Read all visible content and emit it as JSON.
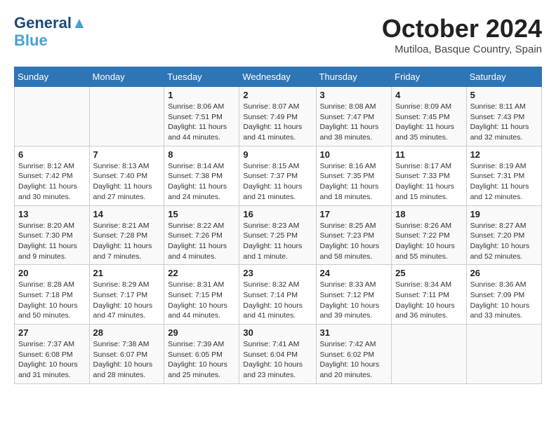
{
  "logo": {
    "line1": "General",
    "line2": "Blue"
  },
  "title": "October 2024",
  "location": "Mutiloa, Basque Country, Spain",
  "headers": [
    "Sunday",
    "Monday",
    "Tuesday",
    "Wednesday",
    "Thursday",
    "Friday",
    "Saturday"
  ],
  "weeks": [
    [
      {
        "day": "",
        "detail": ""
      },
      {
        "day": "",
        "detail": ""
      },
      {
        "day": "1",
        "detail": "Sunrise: 8:06 AM\nSunset: 7:51 PM\nDaylight: 11 hours and 44 minutes."
      },
      {
        "day": "2",
        "detail": "Sunrise: 8:07 AM\nSunset: 7:49 PM\nDaylight: 11 hours and 41 minutes."
      },
      {
        "day": "3",
        "detail": "Sunrise: 8:08 AM\nSunset: 7:47 PM\nDaylight: 11 hours and 38 minutes."
      },
      {
        "day": "4",
        "detail": "Sunrise: 8:09 AM\nSunset: 7:45 PM\nDaylight: 11 hours and 35 minutes."
      },
      {
        "day": "5",
        "detail": "Sunrise: 8:11 AM\nSunset: 7:43 PM\nDaylight: 11 hours and 32 minutes."
      }
    ],
    [
      {
        "day": "6",
        "detail": "Sunrise: 8:12 AM\nSunset: 7:42 PM\nDaylight: 11 hours and 30 minutes."
      },
      {
        "day": "7",
        "detail": "Sunrise: 8:13 AM\nSunset: 7:40 PM\nDaylight: 11 hours and 27 minutes."
      },
      {
        "day": "8",
        "detail": "Sunrise: 8:14 AM\nSunset: 7:38 PM\nDaylight: 11 hours and 24 minutes."
      },
      {
        "day": "9",
        "detail": "Sunrise: 8:15 AM\nSunset: 7:37 PM\nDaylight: 11 hours and 21 minutes."
      },
      {
        "day": "10",
        "detail": "Sunrise: 8:16 AM\nSunset: 7:35 PM\nDaylight: 11 hours and 18 minutes."
      },
      {
        "day": "11",
        "detail": "Sunrise: 8:17 AM\nSunset: 7:33 PM\nDaylight: 11 hours and 15 minutes."
      },
      {
        "day": "12",
        "detail": "Sunrise: 8:19 AM\nSunset: 7:31 PM\nDaylight: 11 hours and 12 minutes."
      }
    ],
    [
      {
        "day": "13",
        "detail": "Sunrise: 8:20 AM\nSunset: 7:30 PM\nDaylight: 11 hours and 9 minutes."
      },
      {
        "day": "14",
        "detail": "Sunrise: 8:21 AM\nSunset: 7:28 PM\nDaylight: 11 hours and 7 minutes."
      },
      {
        "day": "15",
        "detail": "Sunrise: 8:22 AM\nSunset: 7:26 PM\nDaylight: 11 hours and 4 minutes."
      },
      {
        "day": "16",
        "detail": "Sunrise: 8:23 AM\nSunset: 7:25 PM\nDaylight: 11 hours and 1 minute."
      },
      {
        "day": "17",
        "detail": "Sunrise: 8:25 AM\nSunset: 7:23 PM\nDaylight: 10 hours and 58 minutes."
      },
      {
        "day": "18",
        "detail": "Sunrise: 8:26 AM\nSunset: 7:22 PM\nDaylight: 10 hours and 55 minutes."
      },
      {
        "day": "19",
        "detail": "Sunrise: 8:27 AM\nSunset: 7:20 PM\nDaylight: 10 hours and 52 minutes."
      }
    ],
    [
      {
        "day": "20",
        "detail": "Sunrise: 8:28 AM\nSunset: 7:18 PM\nDaylight: 10 hours and 50 minutes."
      },
      {
        "day": "21",
        "detail": "Sunrise: 8:29 AM\nSunset: 7:17 PM\nDaylight: 10 hours and 47 minutes."
      },
      {
        "day": "22",
        "detail": "Sunrise: 8:31 AM\nSunset: 7:15 PM\nDaylight: 10 hours and 44 minutes."
      },
      {
        "day": "23",
        "detail": "Sunrise: 8:32 AM\nSunset: 7:14 PM\nDaylight: 10 hours and 41 minutes."
      },
      {
        "day": "24",
        "detail": "Sunrise: 8:33 AM\nSunset: 7:12 PM\nDaylight: 10 hours and 39 minutes."
      },
      {
        "day": "25",
        "detail": "Sunrise: 8:34 AM\nSunset: 7:11 PM\nDaylight: 10 hours and 36 minutes."
      },
      {
        "day": "26",
        "detail": "Sunrise: 8:36 AM\nSunset: 7:09 PM\nDaylight: 10 hours and 33 minutes."
      }
    ],
    [
      {
        "day": "27",
        "detail": "Sunrise: 7:37 AM\nSunset: 6:08 PM\nDaylight: 10 hours and 31 minutes."
      },
      {
        "day": "28",
        "detail": "Sunrise: 7:38 AM\nSunset: 6:07 PM\nDaylight: 10 hours and 28 minutes."
      },
      {
        "day": "29",
        "detail": "Sunrise: 7:39 AM\nSunset: 6:05 PM\nDaylight: 10 hours and 25 minutes."
      },
      {
        "day": "30",
        "detail": "Sunrise: 7:41 AM\nSunset: 6:04 PM\nDaylight: 10 hours and 23 minutes."
      },
      {
        "day": "31",
        "detail": "Sunrise: 7:42 AM\nSunset: 6:02 PM\nDaylight: 10 hours and 20 minutes."
      },
      {
        "day": "",
        "detail": ""
      },
      {
        "day": "",
        "detail": ""
      }
    ]
  ]
}
